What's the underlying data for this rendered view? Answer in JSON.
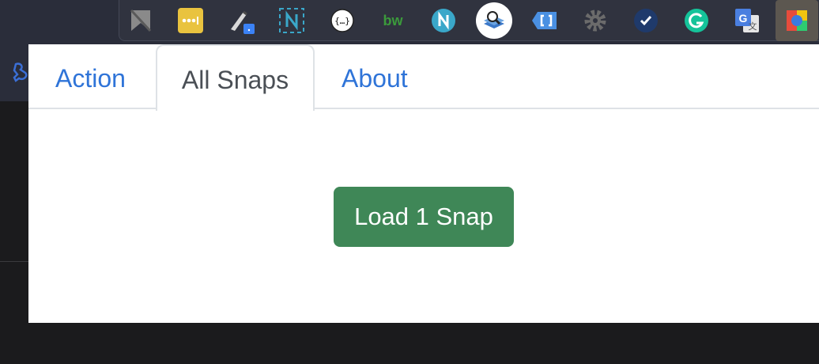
{
  "extensions": [
    {
      "name": "bookmark-arrow-icon",
      "color": "#8a8a8a"
    },
    {
      "name": "password-dots-icon",
      "color": "#e9c33f"
    },
    {
      "name": "pen-tool-icon",
      "color": "#3b82f6",
      "badge": "."
    },
    {
      "name": "notion-clipper-icon",
      "color": "#3aa7c9"
    },
    {
      "name": "json-braces-icon",
      "color": "#ffffff"
    },
    {
      "name": "bw-icon",
      "color": "#3b9a3b",
      "text": "bw"
    },
    {
      "name": "n-circle-icon",
      "color": "#3aa7c9",
      "text": "N"
    },
    {
      "name": "snaps-search-icon",
      "color": "#ffffff"
    },
    {
      "name": "tag-bracket-icon",
      "color": "#4a90e2"
    },
    {
      "name": "gear-extension-icon",
      "color": "#6b6b6b"
    },
    {
      "name": "checkmark-circle-icon",
      "color": "#1f3a6b"
    },
    {
      "name": "grammarly-icon",
      "color": "#15c39a",
      "text": "G"
    },
    {
      "name": "google-translate-icon",
      "color": "#4a7fe0",
      "text": "G"
    },
    {
      "name": "color-picker-icon",
      "color": "#5c5750"
    }
  ],
  "tabs": {
    "action": "Action",
    "all_snaps": "All Snaps",
    "about": "About"
  },
  "active_tab": "All Snaps",
  "load_button": "Load 1 Snap",
  "colors": {
    "link": "#2f74d8",
    "button": "#3f8757",
    "active_tab_text": "#4a4f55"
  }
}
